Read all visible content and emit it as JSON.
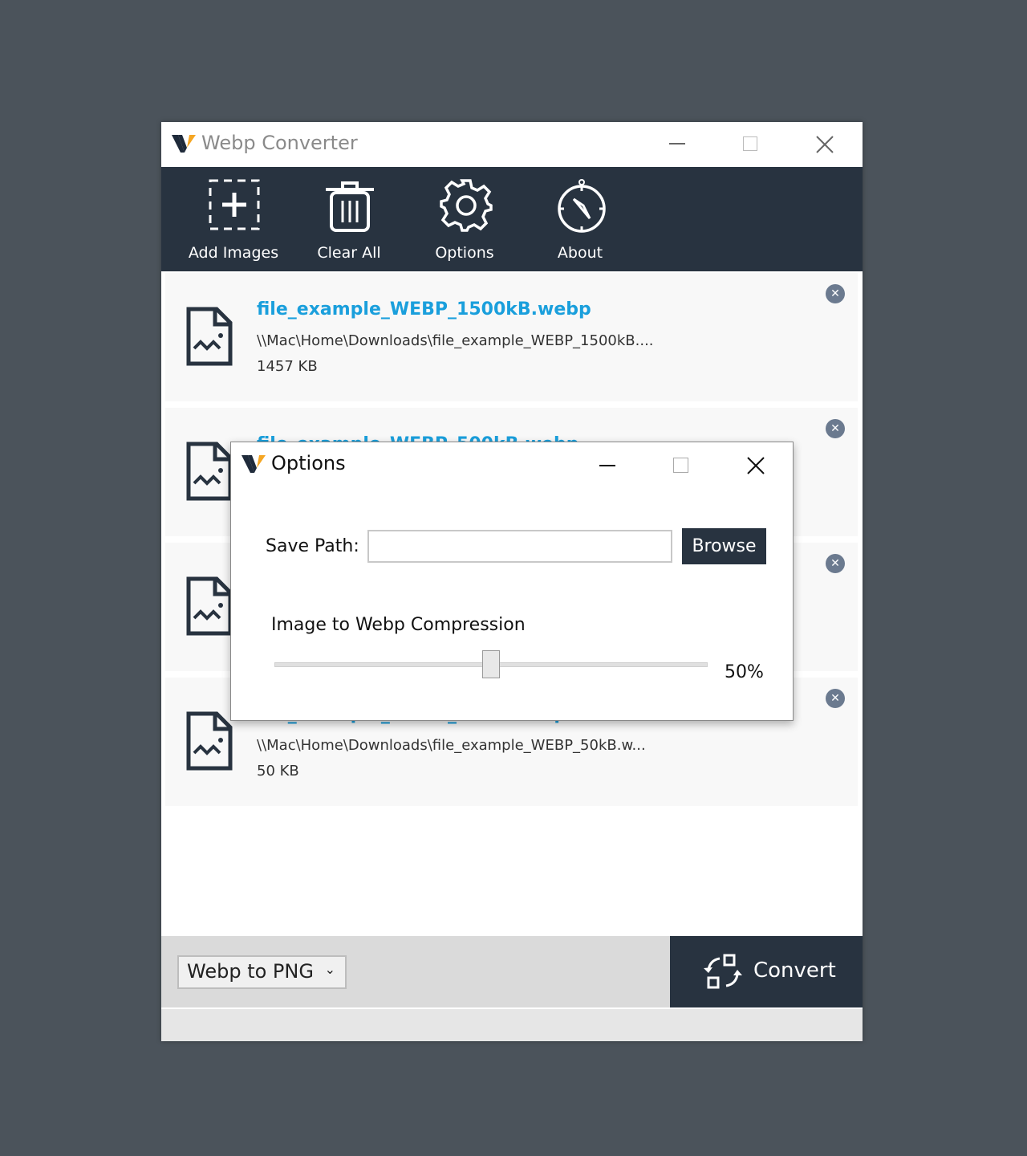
{
  "app": {
    "title": "Webp Converter"
  },
  "toolbar": {
    "items": [
      {
        "label": "Add Images",
        "icon": "add-image-icon"
      },
      {
        "label": "Clear All",
        "icon": "trash-icon"
      },
      {
        "label": "Options",
        "icon": "gear-icon"
      },
      {
        "label": "About",
        "icon": "compass-icon"
      }
    ]
  },
  "files": [
    {
      "name": "file_example_WEBP_1500kB.webp",
      "path": "\\\\Mac\\Home\\Downloads\\file_example_WEBP_1500kB....",
      "size": "1457 KB"
    },
    {
      "name": "file_example_WEBP_500kB.webp"
    },
    {},
    {
      "name": "file_example_WEBP_50kB.webp",
      "path": "\\\\Mac\\Home\\Downloads\\file_example_WEBP_50kB.w...",
      "size": "50 KB"
    }
  ],
  "bottom": {
    "format": "Webp to PNG",
    "convert_label": "Convert"
  },
  "dialog": {
    "title": "Options",
    "save_path_label": "Save Path:",
    "save_path_value": "",
    "browse_label": "Browse",
    "compression_label": "Image to Webp Compression",
    "compression_value": "50%",
    "compression_fraction": 0.5
  },
  "colors": {
    "toolbar": "#283340",
    "accent": "#1a9fdc",
    "logo_orange": "#f5a623"
  }
}
